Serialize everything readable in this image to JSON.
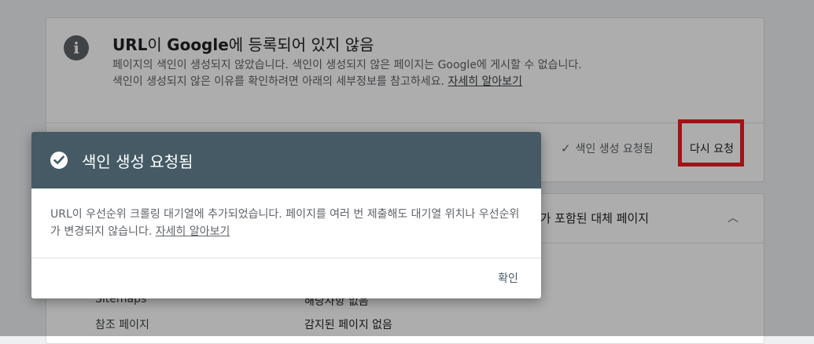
{
  "status_card": {
    "title_brand": "URL",
    "title_part1": "이 ",
    "title_google": "Google",
    "title_part2": "에 등록되어 있지 않음",
    "description": "페이지의 색인이 생성되지 않았습니다. 색인이 생성되지 않은 페이지는 Google에 게시할 수 없습니다. 색인이 생성되지 않은 이유를 확인하려면 아래의 세부정보를 참고하세요. ",
    "learn_more": "자세히 알아보기",
    "request_status": "색인 생성 요청됨",
    "rerequest_label": "다시 요청"
  },
  "coverage_card": {
    "title": "태그가 포함된 대체 페이지",
    "rows": [
      {
        "label": "Sitemaps",
        "value": "해당사항 없음"
      },
      {
        "label": "참조 페이지",
        "value": "감지된 페이지 없음"
      }
    ]
  },
  "dialog": {
    "title": "색인 생성 요청됨",
    "body": "URL이 우선순위 크롤링 대기열에 추가되었습니다. 페이지를 여러 번 제출해도 대기열 위치나 우선순위가 변경되지 않습니다. ",
    "learn_more": "자세히 알아보기",
    "confirm_label": "확인",
    "header_color": "#455a64"
  },
  "highlight_color": "#ee1c24"
}
